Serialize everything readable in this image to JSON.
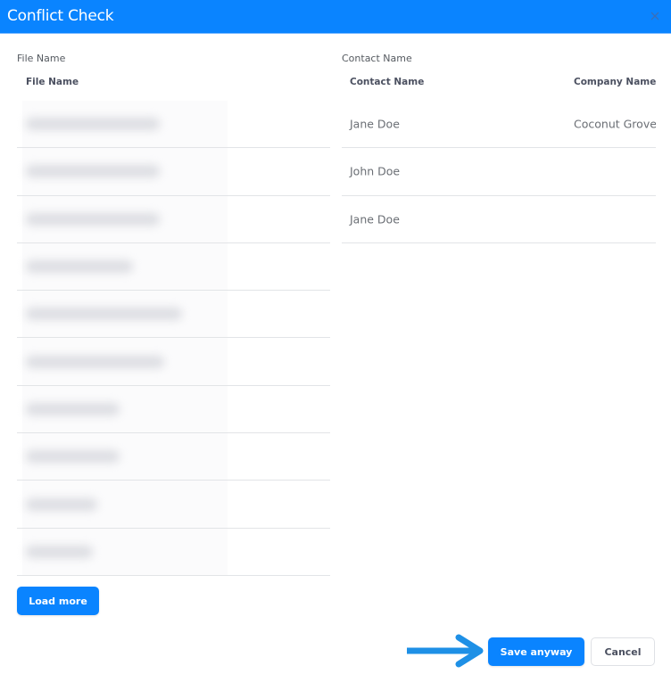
{
  "dialog": {
    "title": "Conflict Check",
    "close_icon": "close-icon",
    "accent_color": "#0a84ff"
  },
  "files_section": {
    "label": "File Name",
    "column_header": "File Name",
    "rows_redacted": true,
    "row_count": 10
  },
  "contacts_section": {
    "label": "Contact Name",
    "columns": [
      "Contact Name",
      "Company Name"
    ],
    "rows": [
      {
        "contact_name": "Jane Doe",
        "company_name": "Coconut Grove"
      },
      {
        "contact_name": "John Doe",
        "company_name": ""
      },
      {
        "contact_name": "Jane Doe",
        "company_name": ""
      }
    ]
  },
  "buttons": {
    "load_more": "Load more",
    "save_anyway": "Save anyway",
    "cancel": "Cancel"
  },
  "annotation": {
    "arrow_icon": "arrow-right-icon",
    "arrow_color": "#1e90e6"
  }
}
